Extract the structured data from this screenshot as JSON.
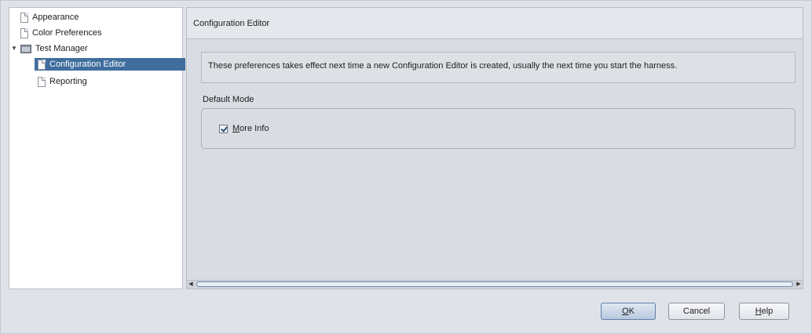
{
  "tree": {
    "items": [
      {
        "label": "Appearance",
        "icon": "page-icon"
      },
      {
        "label": "Color Preferences",
        "icon": "page-icon"
      },
      {
        "label": "Test Manager",
        "icon": "folder-icon",
        "expanded": true
      },
      {
        "label": "Configuration Editor",
        "icon": "page-icon",
        "selected": true
      },
      {
        "label": "Reporting",
        "icon": "page-icon"
      }
    ]
  },
  "panel": {
    "title": "Configuration Editor",
    "description": "These preferences takes effect next time a new Configuration Editor is created, usually the next time you start the harness.",
    "mode_label": "Default Mode",
    "checkbox": {
      "label": "More Info",
      "checked": true
    }
  },
  "buttons": {
    "ok": "OK",
    "cancel": "Cancel",
    "help": "Help"
  },
  "colors": {
    "selection": "#3f6e9e",
    "background": "#dfe3e9"
  }
}
